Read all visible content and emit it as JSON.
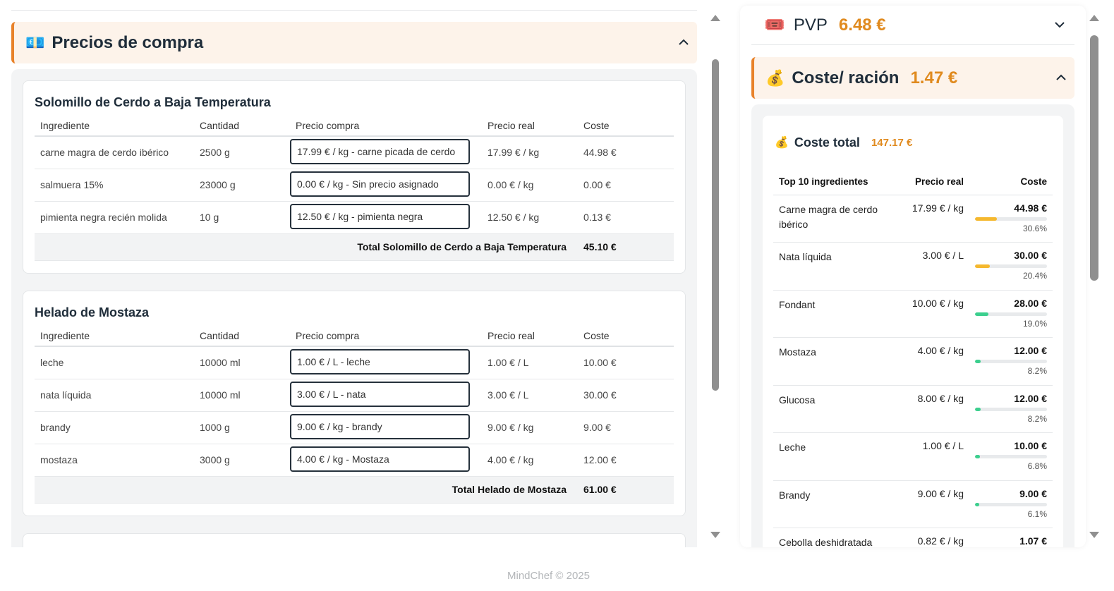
{
  "purchase_section": {
    "emoji": "💶",
    "title": "Precios de compra",
    "columns": {
      "ingredient": "Ingrediente",
      "quantity": "Cantidad",
      "purchase_price": "Precio compra",
      "real_price": "Precio real",
      "cost": "Coste"
    },
    "recipes": [
      {
        "title": "Solomillo de Cerdo a Baja Temperatura",
        "rows": [
          {
            "ingredient": "carne magra de cerdo ibérico",
            "quantity": "2500 g",
            "purchase_price": "17.99 € / kg - carne picada de cerdo",
            "real_price": "17.99 € / kg",
            "cost": "44.98 €"
          },
          {
            "ingredient": "salmuera 15%",
            "quantity": "23000 g",
            "purchase_price": "0.00 € / kg - Sin precio asignado",
            "real_price": "0.00 € / kg",
            "cost": "0.00 €"
          },
          {
            "ingredient": "pimienta negra recién molida",
            "quantity": "10 g",
            "purchase_price": "12.50 € / kg - pimienta negra",
            "real_price": "12.50 € / kg",
            "cost": "0.13 €"
          }
        ],
        "total_label": "Total Solomillo de Cerdo a Baja Temperatura",
        "total_value": "45.10 €"
      },
      {
        "title": "Helado de Mostaza",
        "rows": [
          {
            "ingredient": "leche",
            "quantity": "10000 ml",
            "purchase_price": "1.00 € / L - leche",
            "real_price": "1.00 € / L",
            "cost": "10.00 €"
          },
          {
            "ingredient": "nata líquida",
            "quantity": "10000 ml",
            "purchase_price": "3.00 € / L - nata",
            "real_price": "3.00 € / L",
            "cost": "30.00 €"
          },
          {
            "ingredient": "brandy",
            "quantity": "1000 g",
            "purchase_price": "9.00 € / kg - brandy",
            "real_price": "9.00 € / kg",
            "cost": "9.00 €"
          },
          {
            "ingredient": "mostaza",
            "quantity": "3000 g",
            "purchase_price": "4.00 € / kg - Mostaza",
            "real_price": "4.00 € / kg",
            "cost": "12.00 €"
          }
        ],
        "total_label": "Total Helado de Mostaza",
        "total_value": "61.00 €"
      }
    ]
  },
  "pvp": {
    "emoji": "🎟️",
    "label": "PVP",
    "value": "6.48 €"
  },
  "coste_racion": {
    "emoji": "💰",
    "label": "Coste/ ración",
    "value": "1.47 €"
  },
  "coste_total": {
    "emoji": "💰",
    "label": "Coste total",
    "value": "147.17 €",
    "columns": {
      "ingredient": "Top 10 ingredientes",
      "real_price": "Precio real",
      "cost": "Coste"
    },
    "rows": [
      {
        "name": "Carne magra de cerdo ibérico",
        "real_price": "17.99 € / kg",
        "cost": "44.98 €",
        "pct": "30.6%",
        "share": 0.306,
        "bar_color": "#f5b82e"
      },
      {
        "name": "Nata líquida",
        "real_price": "3.00 € / L",
        "cost": "30.00 €",
        "pct": "20.4%",
        "share": 0.204,
        "bar_color": "#f5b82e"
      },
      {
        "name": "Fondant",
        "real_price": "10.00 € / kg",
        "cost": "28.00 €",
        "pct": "19.0%",
        "share": 0.19,
        "bar_color": "#3ccf8e"
      },
      {
        "name": "Mostaza",
        "real_price": "4.00 € / kg",
        "cost": "12.00 €",
        "pct": "8.2%",
        "share": 0.082,
        "bar_color": "#3ccf8e"
      },
      {
        "name": "Glucosa",
        "real_price": "8.00 € / kg",
        "cost": "12.00 €",
        "pct": "8.2%",
        "share": 0.082,
        "bar_color": "#3ccf8e"
      },
      {
        "name": "Leche",
        "real_price": "1.00 € / L",
        "cost": "10.00 €",
        "pct": "6.8%",
        "share": 0.068,
        "bar_color": "#3ccf8e"
      },
      {
        "name": "Brandy",
        "real_price": "9.00 € / kg",
        "cost": "9.00 €",
        "pct": "6.1%",
        "share": 0.061,
        "bar_color": "#3ccf8e"
      },
      {
        "name": "Cebolla deshidratada",
        "real_price": "0.82 € / kg",
        "cost": "1.07 €",
        "pct": "",
        "share": null,
        "bar_color": "#3ccf8e"
      }
    ]
  },
  "footer": {
    "text": "MindChef © 2025"
  },
  "icons": {
    "collapse": "chevron-up-icon",
    "expand": "chevron-down-icon"
  }
}
